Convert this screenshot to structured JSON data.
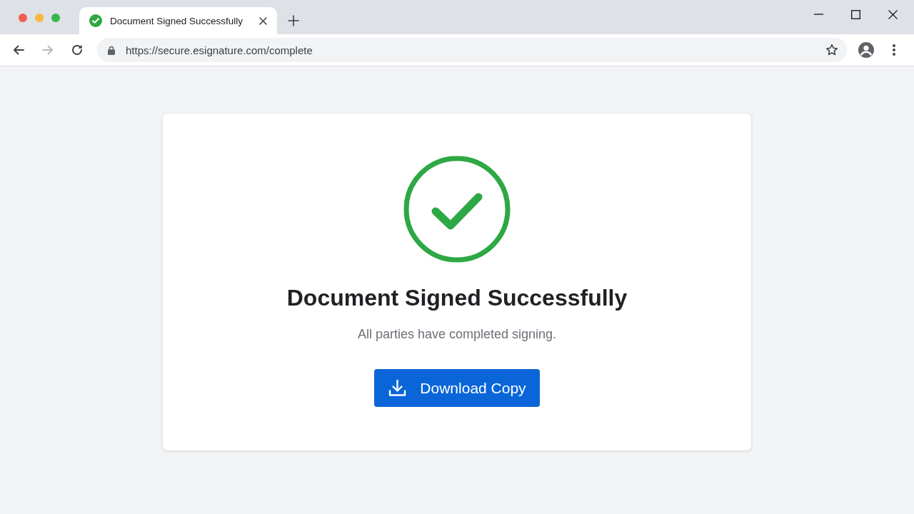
{
  "window": {
    "traffic_lights": [
      {
        "color": "#ee5d50"
      },
      {
        "color": "#f5b83d"
      },
      {
        "color": "#35b84b"
      }
    ]
  },
  "tabs": [
    {
      "title": "Document Signed Successfully",
      "selected": true
    }
  ],
  "toolbar": {
    "nav": [
      {
        "kind": "back",
        "disabled": false
      },
      {
        "kind": "forward",
        "disabled": true
      },
      {
        "kind": "reload",
        "disabled": false
      }
    ],
    "url": "https://secure.esignature.com/complete"
  },
  "card": {
    "title": "Document Signed Successfully",
    "message": "All parties have completed signing.",
    "button": "Download Copy"
  }
}
